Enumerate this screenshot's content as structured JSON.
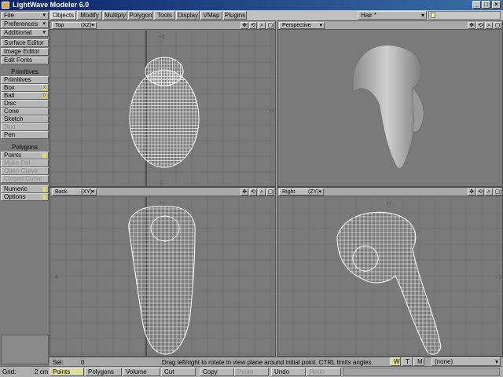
{
  "window": {
    "title": "LightWave Modeler 6.0",
    "min": "_",
    "max": "□",
    "close": "×"
  },
  "tabs": [
    "Objects",
    "Modify",
    "Multiply",
    "Polygon",
    "Tools",
    "Display",
    "VMap",
    "Plugins"
  ],
  "active_tab": "Objects",
  "layer_select": "Hair *",
  "sidebar": {
    "menus": [
      "File",
      "Preferences",
      "Additional"
    ],
    "tools": [
      "Surface Editor",
      "Image Editor",
      "Edit Fonts"
    ],
    "primitives_header": "Primitives",
    "primitives": [
      "Primitives",
      "Box",
      "Ball",
      "Disc",
      "Cone",
      "Sketch",
      "Text",
      "Pen"
    ],
    "primitive_keys": {
      "Box": "X",
      "Ball": "O"
    },
    "disabled": [
      "Text",
      "Make Pol",
      "Open Curve",
      "Closed Curve"
    ],
    "polygons_header": "Polygons",
    "polygons": [
      "Points",
      "Make Pol",
      "Open Curve",
      "Closed Curve"
    ],
    "bottom": [
      "Numeric",
      "Options"
    ],
    "grid_label": "Grid:",
    "grid_value": "2 cm"
  },
  "viewports": [
    {
      "name": "top",
      "label": "Top",
      "axes": "(XZ)"
    },
    {
      "name": "perspective",
      "label": "Perspective",
      "axes": ""
    },
    {
      "name": "back",
      "label": "Back",
      "axes": "(XY)"
    },
    {
      "name": "right",
      "label": "Right",
      "axes": "(ZY)"
    }
  ],
  "viewport_icons": [
    "move-icon",
    "rotate-icon",
    "zoom-icon",
    "maximize-icon"
  ],
  "status": {
    "sel_label": "Sel:",
    "sel_value": "0",
    "help": "Drag left/right to rotate in view plane around initial point. CTRL limits angles.",
    "wtm": [
      "W",
      "T",
      "M"
    ],
    "vmap": "(none)"
  },
  "modes": [
    "Points",
    "Polygons",
    "Volume"
  ],
  "active_mode": "Points",
  "edit_buttons": [
    "Cut",
    "Copy",
    "Paste",
    "Undo",
    "Redo"
  ],
  "disabled_edit": [
    "Paste",
    "Redo"
  ],
  "colors": {
    "viewport_bg": "#7a7a7a",
    "wire": "#ffffff",
    "title": "#0a246a",
    "mode_active": "#dcdc9c"
  }
}
